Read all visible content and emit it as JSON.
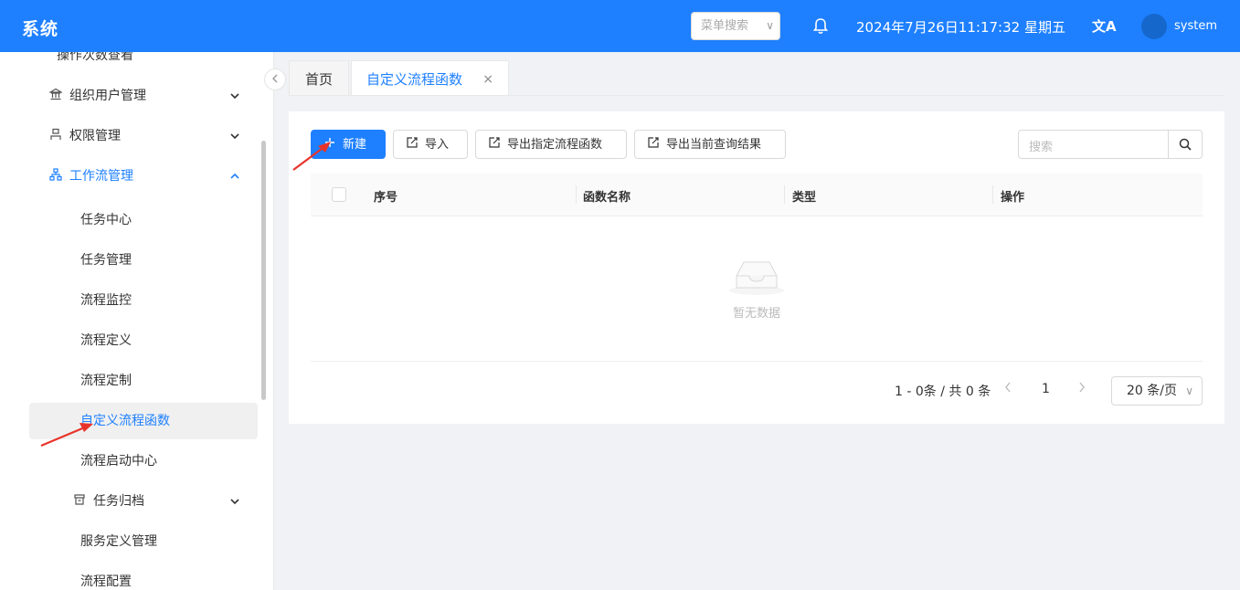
{
  "header": {
    "title": "系统",
    "menu_search_placeholder": "菜单搜索",
    "datetime": "2024年7月26日11:17:32 星期五",
    "translate_icon": "文A",
    "username": "system",
    "brand_color": "#1e80ff"
  },
  "sidebar": {
    "top_cut_item": "操作次数查看",
    "items": [
      {
        "label": "组织用户管理",
        "icon": "bank-icon"
      },
      {
        "label": "权限管理",
        "icon": "user-icon"
      },
      {
        "label": "工作流管理",
        "icon": "flow-icon"
      }
    ],
    "sub_items": [
      "任务中心",
      "任务管理",
      "流程监控",
      "流程定义",
      "流程定制",
      "自定义流程函数",
      "流程启动中心"
    ],
    "archive": {
      "label": "任务归档",
      "icon": "archive-icon"
    },
    "after_items": [
      "服务定义管理",
      "流程配置"
    ]
  },
  "tabs": {
    "home": "首页",
    "current": "自定义流程函数",
    "close_symbol": "×"
  },
  "toolbar": {
    "new_label": "新建",
    "import_label": "导入",
    "export_selected_label": "导出指定流程函数",
    "export_query_label": "导出当前查询结果",
    "search_placeholder": "搜索"
  },
  "table": {
    "columns": [
      "序号",
      "函数名称",
      "类型",
      "操作"
    ],
    "empty_text": "暂无数据"
  },
  "pagination": {
    "total_text": "1 - 0条 / 共 0 条",
    "current_page": "1",
    "page_size": "20 条/页"
  }
}
